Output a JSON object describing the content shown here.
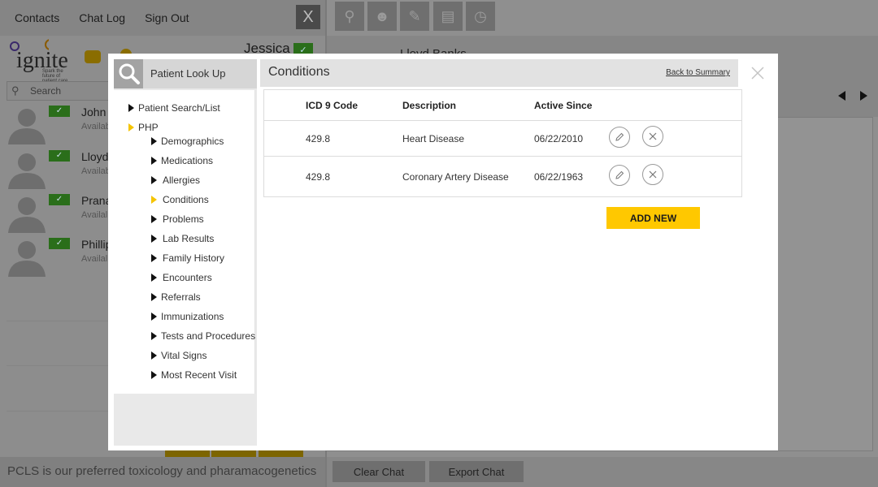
{
  "nav": {
    "items": [
      "Contacts",
      "Chat Log",
      "Sign Out"
    ],
    "close": "X"
  },
  "logo": {
    "word": "ignite",
    "tagline": "Spark the future of patient care"
  },
  "user": {
    "name": "Jessica",
    "status_check": "✓"
  },
  "search": {
    "placeholder": "Search"
  },
  "contacts": [
    {
      "name": "John",
      "status": "Availab"
    },
    {
      "name": "Lloyd",
      "status": "Availab"
    },
    {
      "name": "Prana",
      "status": "Availal"
    },
    {
      "name": "Phillip",
      "status": "Availal"
    }
  ],
  "ticker": "PCLS is our preferred toxicology and pharamacogenetics",
  "chat": {
    "patient_name": "Lloyd Banks",
    "clear_label": "Clear Chat",
    "export_label": "Export Chat"
  },
  "modal": {
    "lookup_title": "Patient Look Up",
    "tree": {
      "patient_search": "Patient Search/List",
      "php": "PHP",
      "children": [
        "Demographics",
        "Medications",
        "Allergies",
        "Conditions",
        "Problems",
        "Lab Results",
        "Family History",
        "Encounters",
        "Referrals",
        "Immunizations",
        "Tests and Procedures",
        "Vital Signs",
        "Most Recent Visit"
      ],
      "active": "Conditions"
    },
    "conditions_title": "Conditions",
    "back_link": "Back to Summary",
    "columns": [
      "ICD 9 Code",
      "Description",
      "Active Since"
    ],
    "rows": [
      {
        "code": "429.8",
        "description": "Heart Disease",
        "since": "06/22/2010"
      },
      {
        "code": "429.8",
        "description": "Coronary Artery Disease",
        "since": "06/22/1963"
      }
    ],
    "add_new_label": "ADD NEW"
  },
  "colors": {
    "accent": "#ffc800",
    "status_green": "#2a6e1a",
    "overlay_gray": "#8d8d8d"
  }
}
